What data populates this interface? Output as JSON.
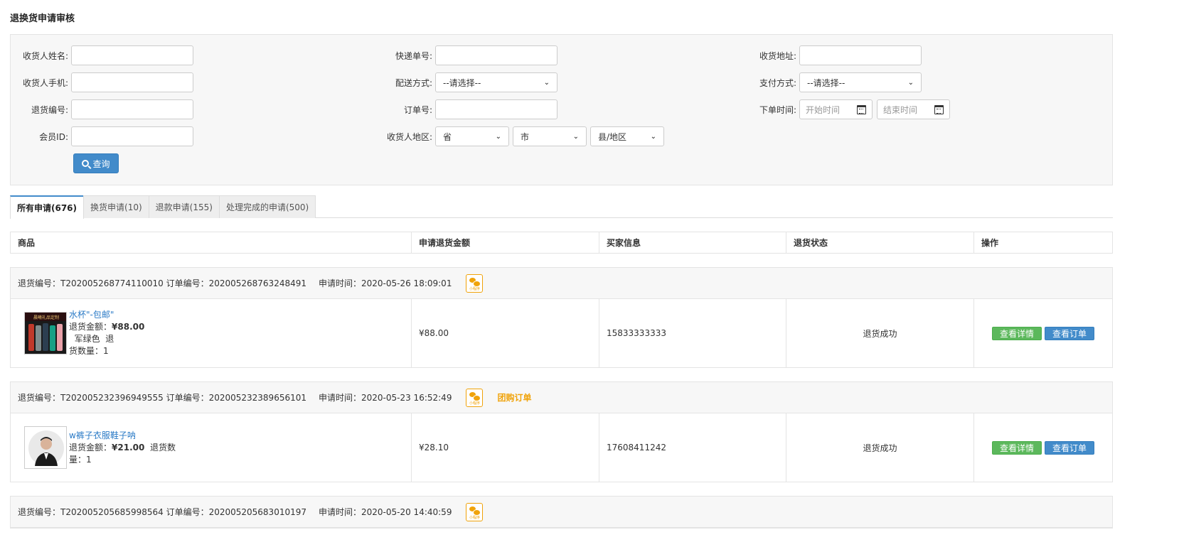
{
  "page": {
    "title": "退换货申请审核"
  },
  "filters": {
    "receiver_name_label": "收货人姓名:",
    "express_no_label": "快递单号:",
    "address_label": "收货地址:",
    "receiver_phone_label": "收货人手机:",
    "delivery_label": "配送方式:",
    "delivery_value": "--请选择--",
    "payment_label": "支付方式:",
    "payment_value": "--请选择--",
    "return_no_label": "退货编号:",
    "order_no_label": "订单号:",
    "order_time_label": "下单时间:",
    "start_placeholder": "开始时间",
    "end_placeholder": "结束时间",
    "member_id_label": "会员ID:",
    "region_label": "收货人地区:",
    "province": "省",
    "city": "市",
    "county": "县/地区",
    "query_button": "查询"
  },
  "tabs": [
    {
      "label": "所有申请(676)",
      "active": true
    },
    {
      "label": "换货申请(10)",
      "active": false
    },
    {
      "label": "退款申请(155)",
      "active": false
    },
    {
      "label": "处理完成的申请(500)",
      "active": false
    }
  ],
  "columns": [
    "商品",
    "申请退货金额",
    "买家信息",
    "退货状态",
    "操作"
  ],
  "orders": [
    {
      "head": "退货编号：T202005268774110010 订单编号：202005268763248491",
      "time": "申请时间：2020-05-26 18:09:01",
      "mini_label": "小程序",
      "tag": "",
      "product_name": "水杯\"-包邮\"",
      "amount_label": "退货金额：",
      "amount": "¥88.00",
      "spec": "  军绿色  退",
      "qty": "货数量：1",
      "apply_amount": "¥88.00",
      "buyer": "15833333333",
      "status": "退货成功",
      "btn_detail": "查看详情",
      "btn_order": "查看订单",
      "thumb_text": "晨曦礼品定制"
    },
    {
      "head": "退货编号：T202005232396949555 订单编号：202005232389656101",
      "time": "申请时间：2020-05-23 16:52:49",
      "mini_label": "小程序",
      "tag": "团购订单",
      "product_name": "w裤子衣服鞋子呐",
      "amount_label": "退货金额：",
      "amount": "¥21.00",
      "spec": "  退货数",
      "qty": "量：1",
      "apply_amount": "¥28.10",
      "buyer": "17608411242",
      "status": "退货成功",
      "btn_detail": "查看详情",
      "btn_order": "查看订单"
    },
    {
      "head": "退货编号：T202005205685998564 订单编号：202005205683010197",
      "time": "申请时间：2020-05-20 14:40:59",
      "mini_label": "小程序"
    }
  ],
  "colors": {
    "primary": "#428bca",
    "success": "#5cb85c",
    "accent": "#f0a30a",
    "link": "#2a7ac6"
  }
}
